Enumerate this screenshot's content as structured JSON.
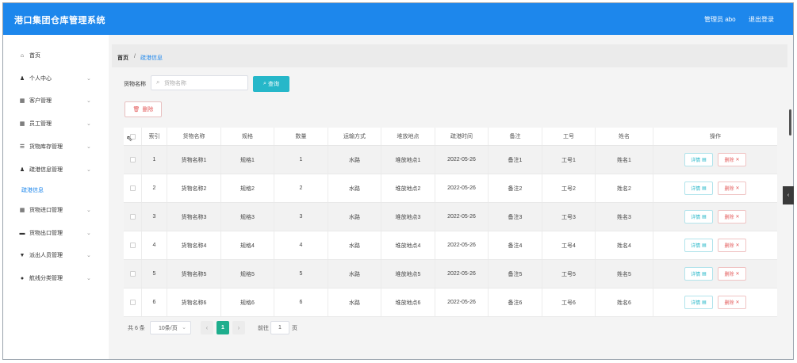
{
  "header": {
    "title": "港口集团仓库管理系统",
    "user_label": "管理员 abo",
    "logout_label": "退出登录",
    "color": "#1d87ec"
  },
  "sidebar": {
    "items": [
      {
        "label": "首页",
        "icon": "home-icon",
        "glyph": "⌂"
      },
      {
        "label": "个人中心",
        "icon": "user-icon",
        "glyph": "♟"
      },
      {
        "label": "客户管理",
        "icon": "grid-icon",
        "glyph": "▦"
      },
      {
        "label": "员工管理",
        "icon": "grid-icon",
        "glyph": "▦"
      },
      {
        "label": "货物库存管理",
        "icon": "list-icon",
        "glyph": "☰"
      },
      {
        "label": "疏港信息管理",
        "icon": "person-icon",
        "glyph": "♟"
      },
      {
        "label": "货物进口管理",
        "icon": "grid-icon",
        "glyph": "▦"
      },
      {
        "label": "货物出口管理",
        "icon": "briefcase-icon",
        "glyph": "▬"
      },
      {
        "label": "派出人员管理",
        "icon": "badge-icon",
        "glyph": "▼"
      },
      {
        "label": "航线分类管理",
        "icon": "pin-icon",
        "glyph": "●"
      }
    ],
    "sub_item": "疏港信息"
  },
  "breadcrumb": {
    "home": "首页",
    "separator": "/",
    "current": "疏港信息"
  },
  "search": {
    "label": "货物名称",
    "placeholder": "货物名称",
    "value": "",
    "query_label": "查询"
  },
  "toolbar": {
    "delete_label": "删除"
  },
  "table": {
    "columns": [
      "索引",
      "货物名称",
      "规格",
      "数量",
      "运输方式",
      "堆放地点",
      "疏港时间",
      "备注",
      "工号",
      "姓名",
      "操作"
    ],
    "rows": [
      [
        "1",
        "货物名称1",
        "规格1",
        "1",
        "水路",
        "堆放地点1",
        "2022-05-26",
        "备注1",
        "工号1",
        "姓名1"
      ],
      [
        "2",
        "货物名称2",
        "规格2",
        "2",
        "水路",
        "堆放地点2",
        "2022-05-26",
        "备注2",
        "工号2",
        "姓名2"
      ],
      [
        "3",
        "货物名称3",
        "规格3",
        "3",
        "水路",
        "堆放地点3",
        "2022-05-26",
        "备注3",
        "工号3",
        "姓名3"
      ],
      [
        "4",
        "货物名称4",
        "规格4",
        "4",
        "水路",
        "堆放地点4",
        "2022-05-26",
        "备注4",
        "工号4",
        "姓名4"
      ],
      [
        "5",
        "货物名称5",
        "规格5",
        "5",
        "水路",
        "堆放地点5",
        "2022-05-26",
        "备注5",
        "工号5",
        "姓名5"
      ],
      [
        "6",
        "货物名称6",
        "规格6",
        "6",
        "水路",
        "堆放地点6",
        "2022-05-26",
        "备注6",
        "工号6",
        "姓名6"
      ]
    ],
    "row_detail_label": "详情",
    "row_delete_label": "删除"
  },
  "pagination": {
    "total_label": "共 6 条",
    "page_size": "10条/页",
    "current_page": "1",
    "goto_label": "前往",
    "goto_value": "1",
    "page_suffix": "页"
  }
}
